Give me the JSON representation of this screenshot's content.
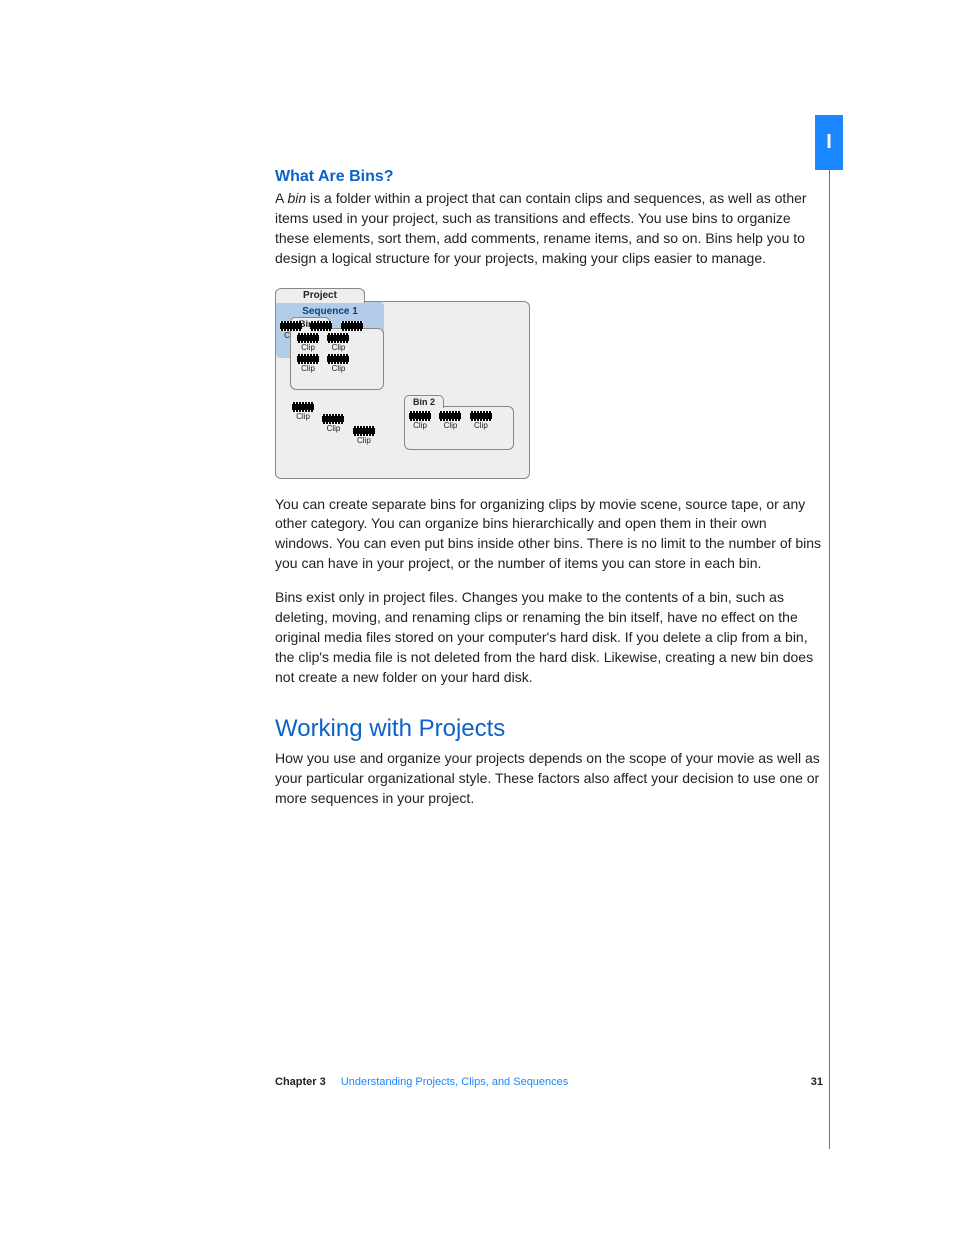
{
  "sideTab": "I",
  "headings": {
    "h1": "What Are Bins?",
    "h2": "Working with Projects"
  },
  "paragraphs": {
    "p1a": "A ",
    "p1_italic": "bin",
    "p1b": " is a folder within a project that can contain clips and sequences, as well as other items used in your project, such as transitions and effects. You use bins to organize these elements, sort them, add comments, rename items, and so on. Bins help you to design a logical structure for your projects, making your clips easier to manage.",
    "p2": "You can create separate bins for organizing clips by movie scene, source tape, or any other category. You can organize bins hierarchically and open them in their own windows. You can even put bins inside other bins. There is no limit to the number of bins you can have in your project, or the number of items you can store in each bin.",
    "p3": "Bins exist only in project files. Changes you make to the contents of a bin, such as deleting, moving, and renaming clips or renaming the bin itself, have no effect on the original media files stored on your computer's hard disk. If you delete a clip from a bin, the clip's media file is not deleted from the hard disk. Likewise, creating a new bin does not create a new folder on your hard disk.",
    "p4": "How you use and organize your projects depends on the scope of your movie as well as your particular organizational style. These factors also affect your decision to use one or more sequences in your project."
  },
  "diagram": {
    "project": "Project",
    "bin1": "Bin 1",
    "bin2": "Bin 2",
    "sequence": "Sequence 1",
    "clip": "Clip"
  },
  "footer": {
    "chapter": "Chapter 3",
    "title": "Understanding Projects, Clips, and Sequences",
    "page": "31"
  }
}
